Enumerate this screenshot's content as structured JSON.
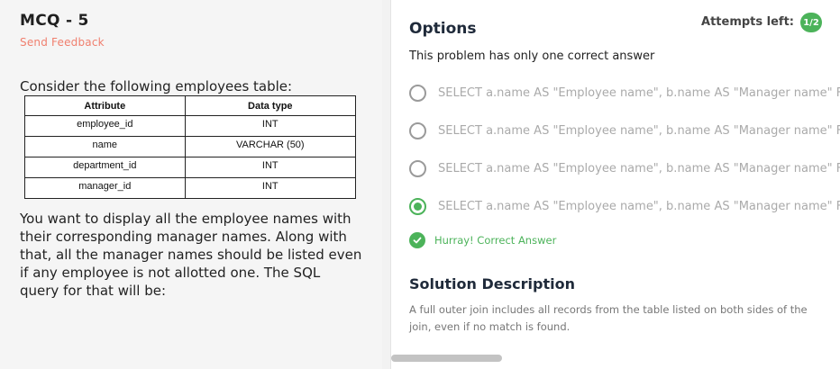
{
  "question": {
    "title": "MCQ - 5",
    "feedback_link": "Send Feedback",
    "intro": "Consider the following employees table:",
    "table": {
      "headers": [
        "Attribute",
        "Data type"
      ],
      "rows": [
        [
          "employee_id",
          "INT"
        ],
        [
          "name",
          "VARCHAR (50)"
        ],
        [
          "department_id",
          "INT"
        ],
        [
          "manager_id",
          "INT"
        ]
      ]
    },
    "body": "You want to display all the employee names with their corresponding manager names. Along with that, all the manager names should be listed even if any employee is not allotted one. The SQL query for that will be:"
  },
  "options_panel": {
    "title": "Options",
    "attempts_label": "Attempts left:",
    "attempts_value": "1/2",
    "instruction": "This problem has only one correct answer",
    "options": [
      {
        "text": "SELECT a.name AS \"Employee name\", b.name AS \"Manager name\" FR",
        "selected": false
      },
      {
        "text": "SELECT a.name AS \"Employee name\", b.name AS \"Manager name\" FR",
        "selected": false
      },
      {
        "text": "SELECT a.name AS \"Employee name\", b.name AS \"Manager name\" FR",
        "selected": false
      },
      {
        "text": "SELECT a.name AS \"Employee name\", b.name AS \"Manager name\" FR",
        "selected": true
      }
    ],
    "result_icon": "check-circle-icon",
    "result_text": "Hurray! Correct Answer",
    "solution_title": "Solution Description",
    "solution_text": "A full outer join includes all records from the table listed on both sides of the join, even if no match is found."
  },
  "colors": {
    "accent_green": "#4cb35a",
    "feedback_red": "#f07f6e"
  }
}
